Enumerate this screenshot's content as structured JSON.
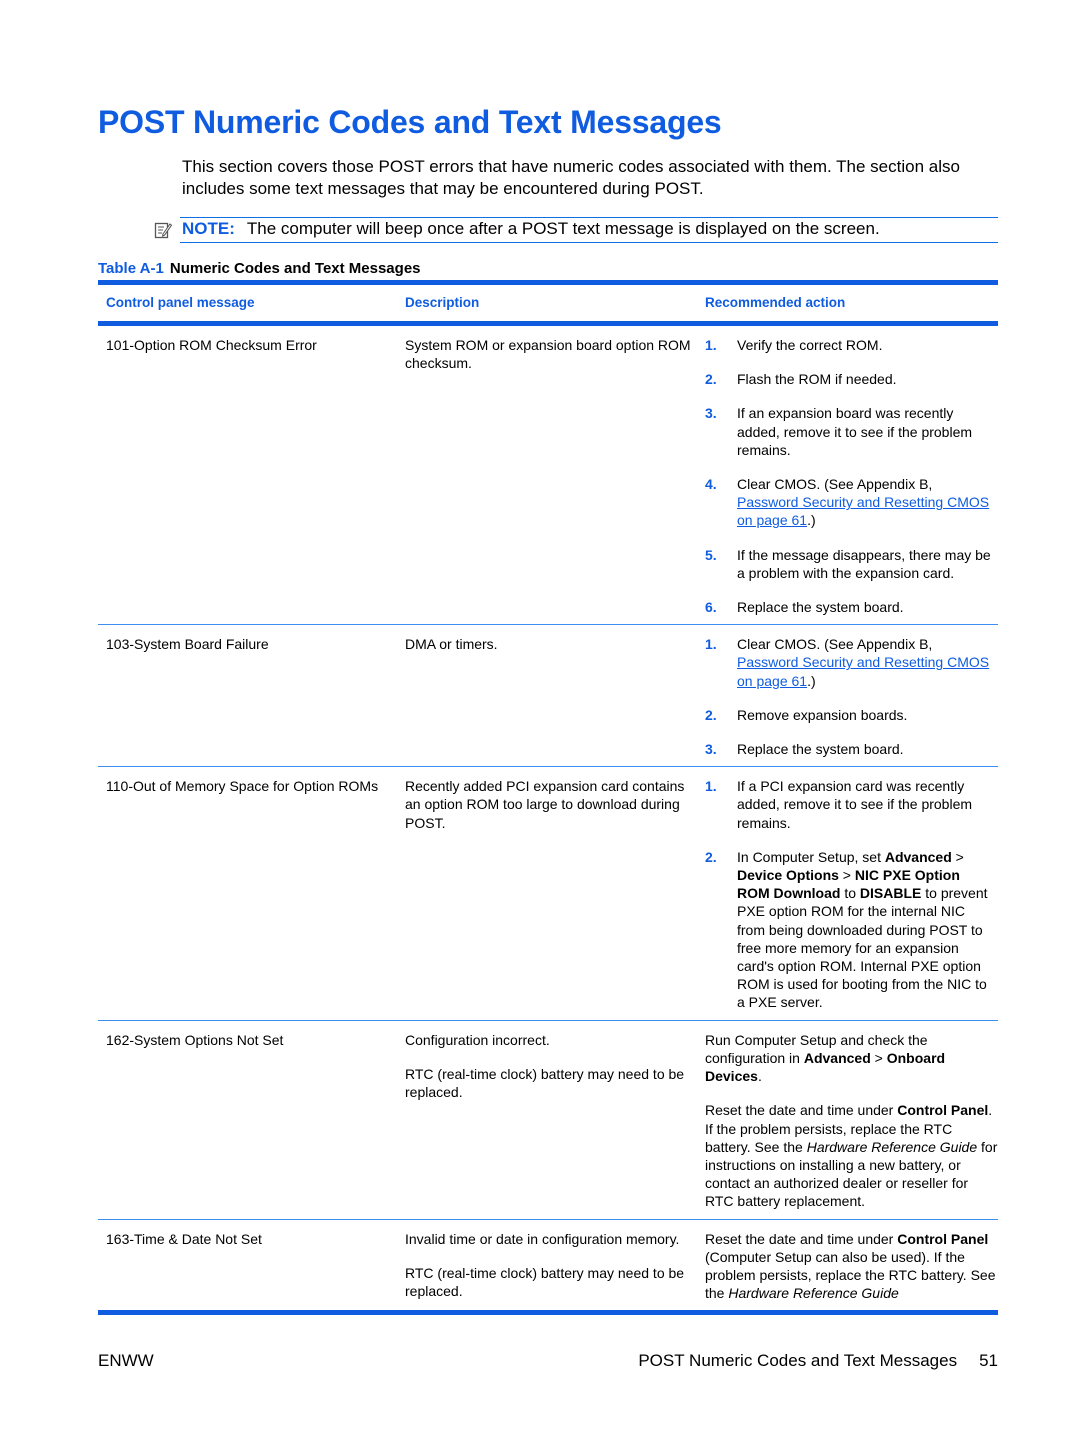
{
  "page": {
    "title": "POST Numeric Codes and Text Messages",
    "intro": "This section covers those POST errors that have numeric codes associated with them. The section also includes some text messages that may be encountered during POST.",
    "note": {
      "icon": "note-pencil-icon",
      "label": "NOTE:",
      "text": "The computer will beep once after a POST text message is displayed on the screen."
    }
  },
  "table": {
    "caption_number": "Table A-1",
    "caption_title": "Numeric Codes and Text Messages",
    "headers": [
      "Control panel message",
      "Description",
      "Recommended action"
    ],
    "rows": [
      {
        "message": "101-Option ROM Checksum Error",
        "description": [
          "System ROM or expansion board option ROM checksum."
        ],
        "steps": [
          {
            "num": "1.",
            "text": "Verify the correct ROM."
          },
          {
            "num": "2.",
            "text": "Flash the ROM if needed."
          },
          {
            "num": "3.",
            "text": "If an expansion board was recently added, remove it to see if the problem remains."
          },
          {
            "num": "4.",
            "pre": "Clear CMOS. (See Appendix B, ",
            "link": "Password Security and Resetting CMOS on page 61",
            "post": ".)"
          },
          {
            "num": "5.",
            "text": "If the message disappears, there may be a problem with the expansion card."
          },
          {
            "num": "6.",
            "text": "Replace the system board."
          }
        ]
      },
      {
        "message": "103-System Board Failure",
        "description": [
          "DMA or timers."
        ],
        "steps": [
          {
            "num": "1.",
            "pre": "Clear CMOS. (See Appendix B, ",
            "link": "Password Security and Resetting CMOS on page 61",
            "post": ".)"
          },
          {
            "num": "2.",
            "text": "Remove expansion boards."
          },
          {
            "num": "3.",
            "text": "Replace the system board."
          }
        ]
      },
      {
        "message": "110-Out of Memory Space for Option ROMs",
        "description": [
          "Recently added PCI expansion card contains an option ROM too large to download during POST."
        ],
        "steps": [
          {
            "num": "1.",
            "text": "If a PCI expansion card was recently added, remove it to see if the problem remains."
          },
          {
            "num": "2.",
            "parts": [
              {
                "t": "In Computer Setup, set "
              },
              {
                "t": "Advanced",
                "b": true
              },
              {
                "t": " > "
              },
              {
                "t": "Device Options",
                "b": true
              },
              {
                "t": " > "
              },
              {
                "t": "NIC PXE Option ROM Download",
                "b": true
              },
              {
                "t": " to "
              },
              {
                "t": "DISABLE",
                "b": true
              },
              {
                "t": " to prevent PXE option ROM for the internal NIC from being downloaded during POST to free more memory for an expansion card's option ROM. Internal PXE option ROM is used for booting from the NIC to a PXE server."
              }
            ]
          }
        ]
      },
      {
        "message": "162-System Options Not Set",
        "description": [
          "Configuration incorrect.",
          "RTC (real-time clock) battery may need to be replaced."
        ],
        "paragraphs": [
          [
            {
              "t": "Run Computer Setup and check the configuration in "
            },
            {
              "t": "Advanced",
              "b": true
            },
            {
              "t": " > "
            },
            {
              "t": "Onboard Devices",
              "b": true
            },
            {
              "t": "."
            }
          ],
          [
            {
              "t": "Reset the date and time under "
            },
            {
              "t": "Control Panel",
              "b": true
            },
            {
              "t": ". If the problem persists, replace the RTC battery. See the "
            },
            {
              "t": "Hardware Reference Guide",
              "i": true
            },
            {
              "t": " for instructions on installing a new battery, or contact an authorized dealer or reseller for RTC battery replacement."
            }
          ]
        ]
      },
      {
        "message": "163-Time & Date Not Set",
        "description": [
          "Invalid time or date in configuration memory.",
          "RTC (real-time clock) battery may need to be replaced."
        ],
        "paragraphs": [
          [
            {
              "t": "Reset the date and time under "
            },
            {
              "t": "Control Panel",
              "b": true
            },
            {
              "t": " (Computer Setup can also be used). If the problem persists, replace the RTC battery. See the "
            },
            {
              "t": "Hardware Reference Guide",
              "i": true
            }
          ]
        ]
      }
    ]
  },
  "footer": {
    "left": "ENWW",
    "section": "POST Numeric Codes and Text Messages",
    "page_number": "51"
  }
}
